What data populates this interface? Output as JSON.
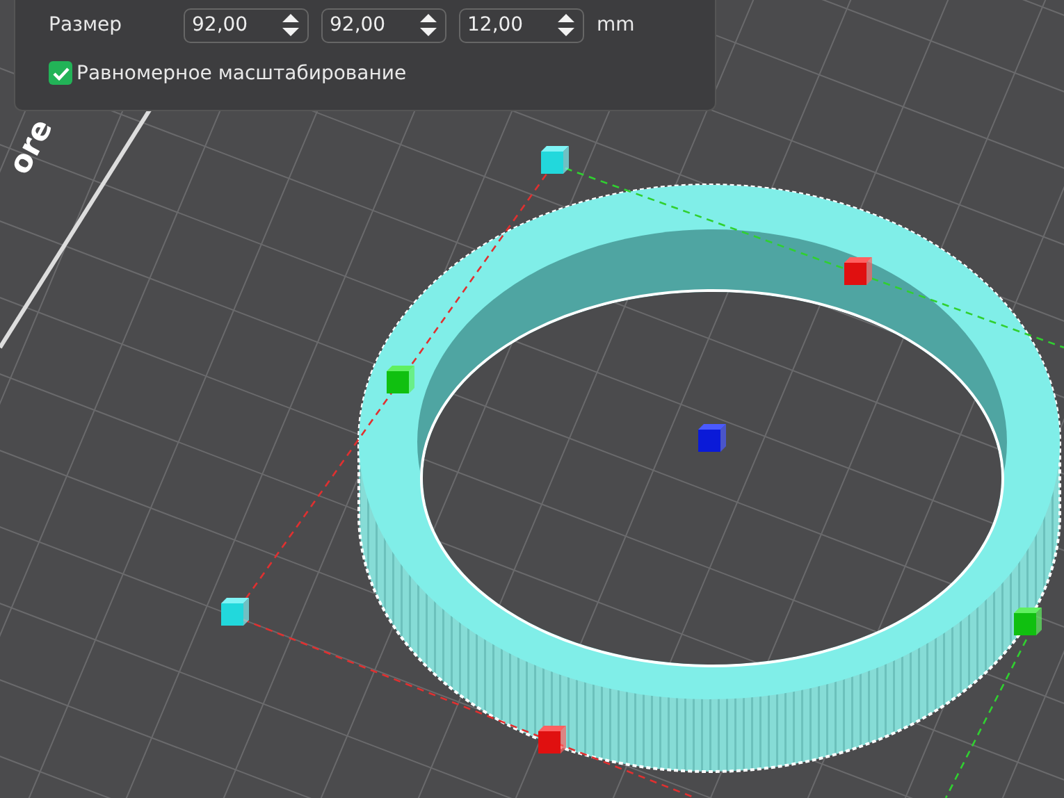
{
  "scale_panel": {
    "size_label": "Размер",
    "fields": [
      {
        "value": "92,00"
      },
      {
        "value": "92,00"
      },
      {
        "value": "12,00"
      }
    ],
    "unit": "mm",
    "uniform_scaling": {
      "label": "Равномерное масштабирование",
      "checked": true
    }
  },
  "bed_label": "ore"
}
